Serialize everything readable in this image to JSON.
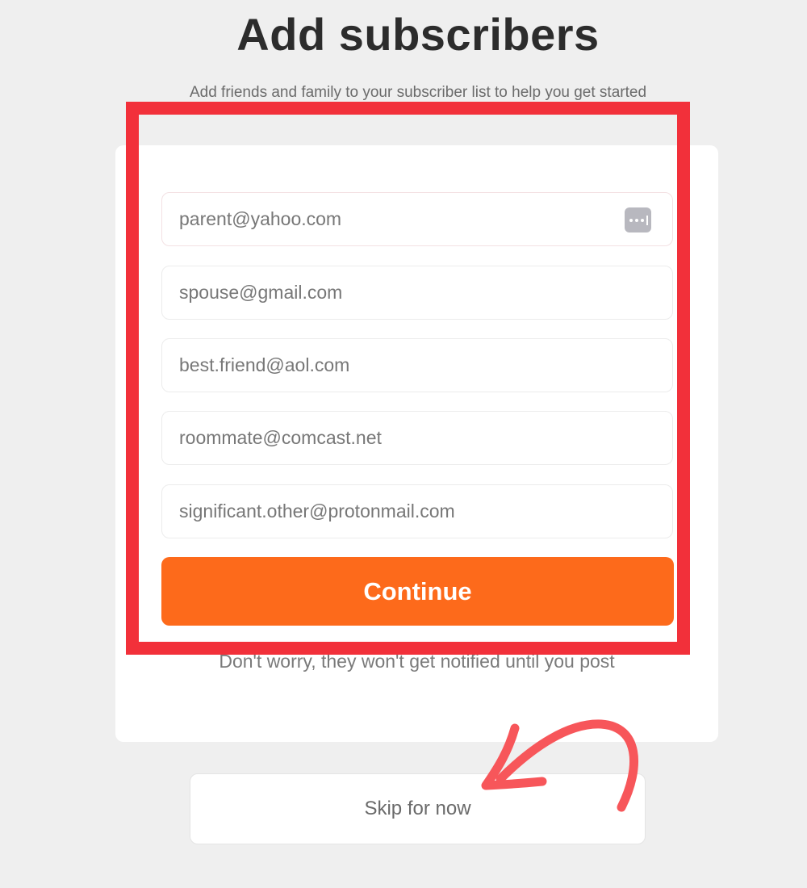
{
  "header": {
    "title": "Add subscribers",
    "subtitle": "Add friends and family to your subscriber list to help you get started"
  },
  "form": {
    "fields": [
      {
        "placeholder": "parent@yahoo.com",
        "icon": "password-manager-icon"
      },
      {
        "placeholder": "spouse@gmail.com"
      },
      {
        "placeholder": "best.friend@aol.com"
      },
      {
        "placeholder": "roommate@comcast.net"
      },
      {
        "placeholder": "significant.other@protonmail.com"
      }
    ],
    "continue_label": "Continue",
    "note": "Don't worry, they won't get notified until you post"
  },
  "skip": {
    "label": "Skip for now"
  },
  "colors": {
    "accent": "#fd6a1b",
    "highlight_box": "#f2303a",
    "annotation_arrow": "#f7565a",
    "background": "#efefef"
  }
}
